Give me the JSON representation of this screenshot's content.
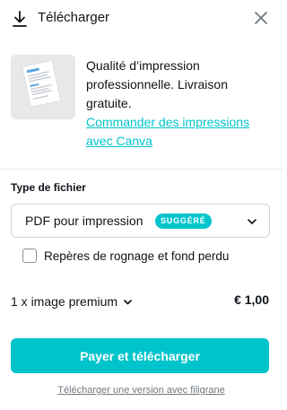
{
  "header": {
    "title": "Télécharger",
    "icon": "download-icon",
    "close_icon": "close-icon"
  },
  "promo": {
    "text": "Qualité d’impression professionnelle. Livraison gratuite.",
    "link": "Commander des impressions avec Canva",
    "thumbnail_icon": "document-thumbnail-icon"
  },
  "file_type": {
    "label": "Type de fichier",
    "selected": "PDF pour impression",
    "badge": "SUGGÉRÉ"
  },
  "crop_marks": {
    "label": "Repères de rognage et fond perdu",
    "checked": false
  },
  "summary": {
    "item": "1 x image premium",
    "price": "€ 1,00"
  },
  "actions": {
    "pay_label": "Payer et télécharger",
    "watermark_label": "Télécharger une version avec filigrane"
  },
  "colors": {
    "accent": "#00c4cc",
    "text": "#0e1318",
    "muted": "#70787f"
  }
}
